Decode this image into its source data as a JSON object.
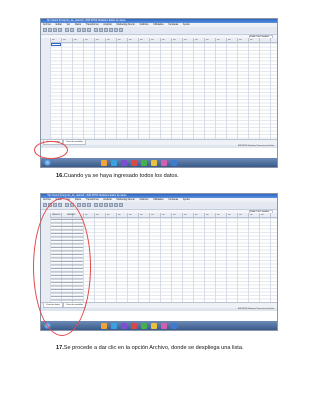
{
  "screen1": {
    "title": "Sin título1 [Conjunto_de_datos0] - IBM SPSS Statistics Editor de datos",
    "menu": [
      "Archivo",
      "Editar",
      "Ver",
      "Datos",
      "Transformar",
      "Analizar",
      "Marketing directo",
      "Gráficos",
      "Utilidades",
      "Ventanas",
      "Ayuda"
    ],
    "visible_label": "Visible: 0 de 0 variables",
    "columns": [
      "var",
      "var",
      "var",
      "var",
      "var",
      "var",
      "var",
      "var",
      "var",
      "var",
      "var",
      "var",
      "var",
      "var",
      "var",
      "var",
      "var",
      "var",
      "var"
    ],
    "tabs": [
      "Vista de datos",
      "Vista de variables"
    ],
    "status": "IBM SPSS Statistics Processor está listo",
    "highlight_color": "#e24a4a"
  },
  "screen2": {
    "title": "*Sin título1 [Conjunto_de_datos0] - IBM SPSS Statistics Editor de datos",
    "menu": [
      "Archivo",
      "Editar",
      "Ver",
      "Datos",
      "Transformar",
      "Analizar",
      "Marketing directo",
      "Gráficos",
      "Utilidades",
      "Ventanas",
      "Ayuda"
    ],
    "visible_label": "Visible: 2 de 2 variables",
    "columns": [
      "VAR00001",
      "VAR00002",
      "var",
      "var",
      "var",
      "var",
      "var",
      "var",
      "var",
      "var",
      "var",
      "var",
      "var",
      "var",
      "var",
      "var",
      "var",
      "var",
      "var"
    ],
    "tabs": [
      "Vista de datos",
      "Vista de variables"
    ],
    "status": "IBM SPSS Statistics Processor está listo",
    "highlight_color": "#e24a4a"
  },
  "captions": {
    "step16_number": "16.",
    "step16_text": "Cuando ya se haya ingresado todos los datos.",
    "step17_number": "17.",
    "step17_text": "Se procede a dar clic en la opción  Archivo, donde se despliega una lista."
  },
  "taskbar_colors": [
    "#f2a33a",
    "#3aa0e0",
    "#7c4fd0",
    "#d84a4a",
    "#46b04f",
    "#e8c23a",
    "#d35fb0",
    "#3b7bd0"
  ]
}
